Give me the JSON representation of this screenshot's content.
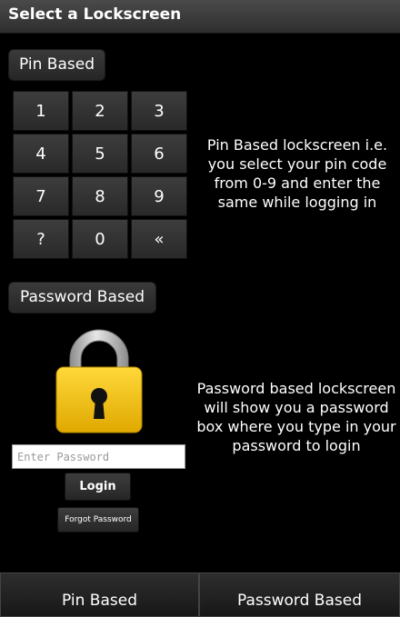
{
  "header": {
    "title": "Select a Lockscreen"
  },
  "pin_section": {
    "button_label": "Pin Based",
    "keypad": {
      "keys": [
        "1",
        "2",
        "3",
        "4",
        "5",
        "6",
        "7",
        "8",
        "9",
        "?",
        "0",
        "«"
      ]
    },
    "description": "Pin Based lockscreen i.e. you select your pin code from 0-9 and enter the same while logging in"
  },
  "password_section": {
    "button_label": "Password Based",
    "lock_icon": "padlock-icon",
    "input_placeholder": "Enter Password",
    "login_label": "Login",
    "forgot_label": "Forgot Password",
    "description": "Password based lockscreen will show you a password box where you type in your password to login"
  },
  "bottom_tabs": {
    "pin_label": "Pin Based",
    "password_label": "Password Based"
  },
  "colors": {
    "background": "#000000",
    "lock_body": "#f5c518",
    "lock_shackle": "#b8b8b8"
  }
}
